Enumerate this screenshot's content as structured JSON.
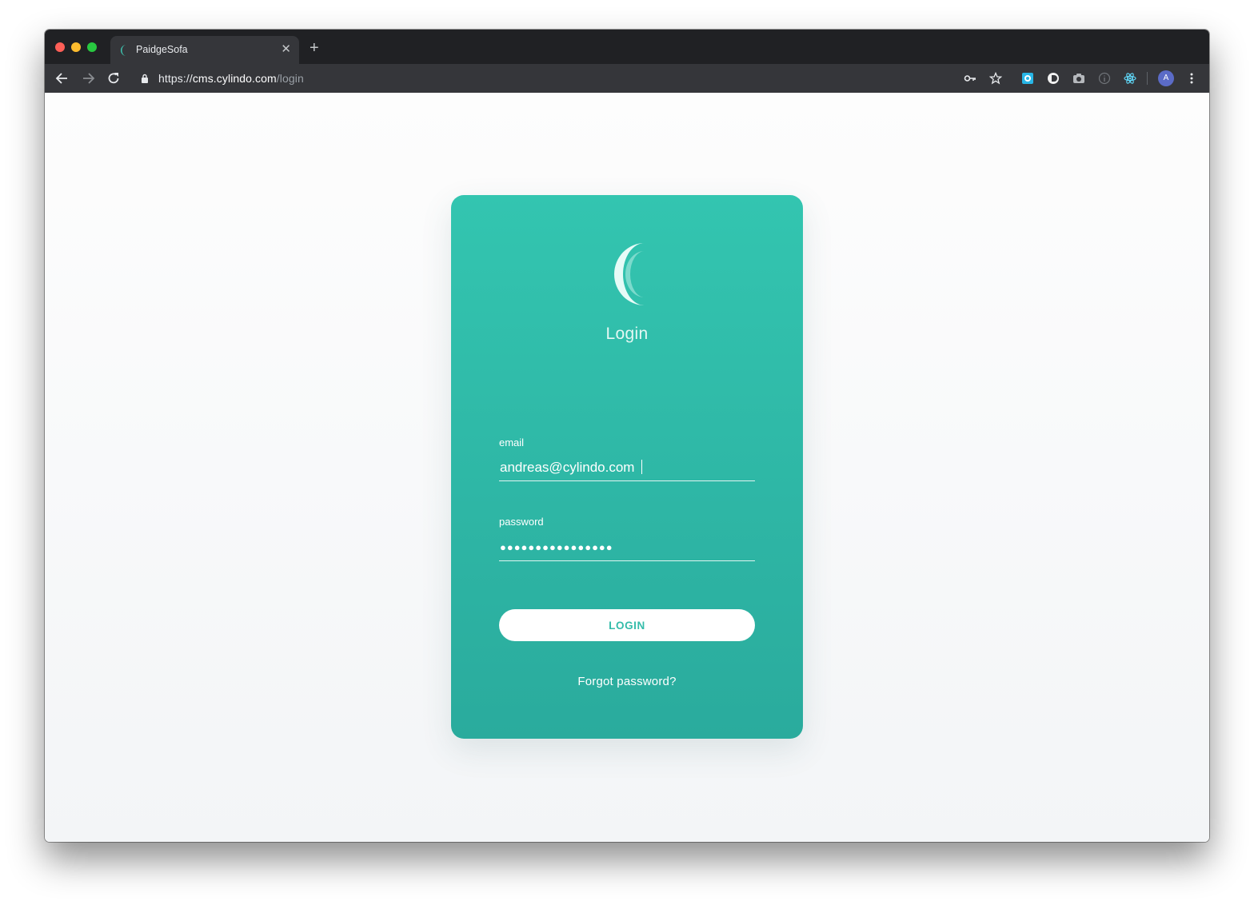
{
  "browser": {
    "tab": {
      "title": "PaidgeSofa",
      "close_glyph": "✕"
    },
    "new_tab_glyph": "+",
    "url": {
      "scheme": "https://",
      "host": "cms.cylindo.com",
      "path": "/login"
    },
    "avatar_initial": "A",
    "toolbar_icons": [
      "key-icon",
      "star-icon",
      "extension-blue-icon",
      "extension-circle-icon",
      "camera-icon",
      "info-icon",
      "react-icon",
      "menu-icon"
    ]
  },
  "login": {
    "title": "Login",
    "email_label": "email",
    "email_value": "andreas@cylindo.com",
    "password_label": "password",
    "password_value": "●●●●●●●●●●●●●●●●",
    "button_label": "LOGIN",
    "forgot_label": "Forgot password?"
  },
  "colors": {
    "card_top": "#33c5b0",
    "card_bottom": "#2aab9d",
    "button_text": "#34bcaa",
    "chrome_dark": "#202124",
    "chrome_toolbar": "#35363a"
  }
}
